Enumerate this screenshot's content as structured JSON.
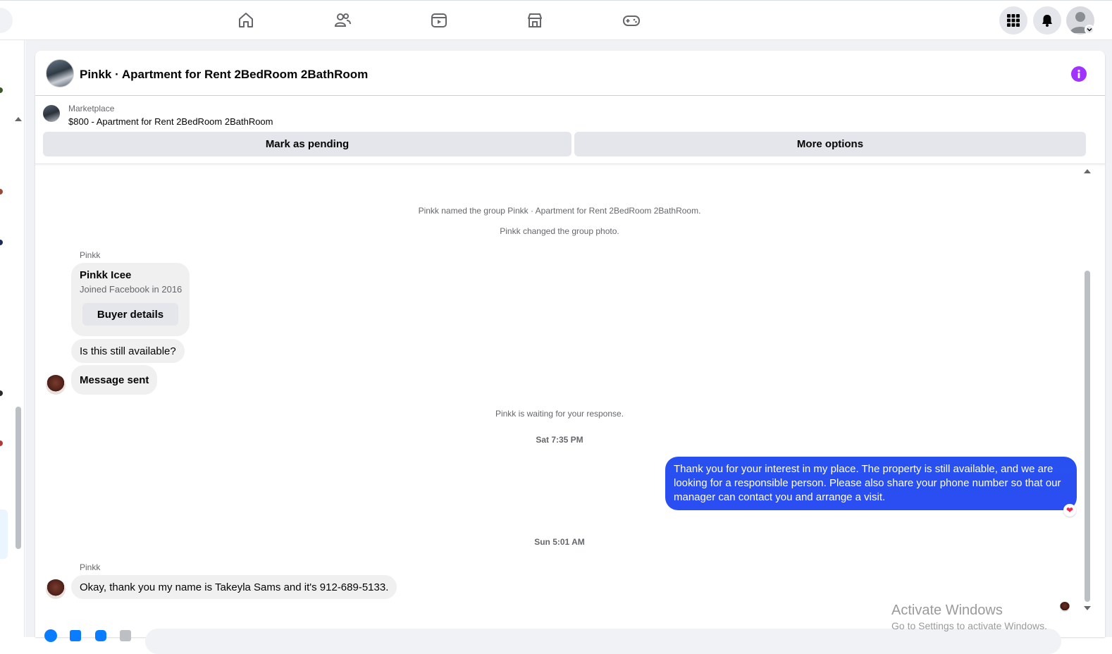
{
  "nav": {
    "icons": [
      "home-icon",
      "friends-icon",
      "video-icon",
      "marketplace-icon",
      "gaming-icon"
    ],
    "right_icons": [
      "menu-grid-icon",
      "notifications-bell-icon",
      "account-avatar-icon"
    ]
  },
  "conversation": {
    "title": "Pinkk · Apartment for Rent 2BedRoom 2BathRoom"
  },
  "listing": {
    "label": "Marketplace",
    "price_title": "$800 - Apartment for Rent 2BedRoom 2BathRoom",
    "mark_pending_label": "Mark as pending",
    "more_options_label": "More options"
  },
  "messages": {
    "system_1": "Pinkk named the group Pinkk · Apartment for Rent 2BedRoom 2BathRoom.",
    "system_2": "Pinkk changed the group photo.",
    "sender_1": "Pinkk",
    "buyer_card": {
      "name": "Pinkk Icee",
      "joined": "Joined Facebook in 2016",
      "button": "Buyer details"
    },
    "incoming_1": "Is this still available?",
    "incoming_2": "Message sent",
    "waiting": "Pinkk is waiting for your response.",
    "timestamp_1": "Sat 7:35 PM",
    "outgoing_1": "Thank you for your interest in my place. The property is still available, and we are looking for a responsible person. Please also share your phone number so that our manager can contact you and arrange a visit.",
    "timestamp_2": "Sun 5:01 AM",
    "sender_2": "Pinkk",
    "incoming_3": "Okay, thank you my name is Takeyla Sams and it's 912-689-5133."
  },
  "watermark": {
    "line1": "Activate Windows",
    "line2": "Go to Settings to activate Windows."
  },
  "colors": {
    "accent": "#0a7cff",
    "info": "#a033ff",
    "heart": "#f02849"
  }
}
